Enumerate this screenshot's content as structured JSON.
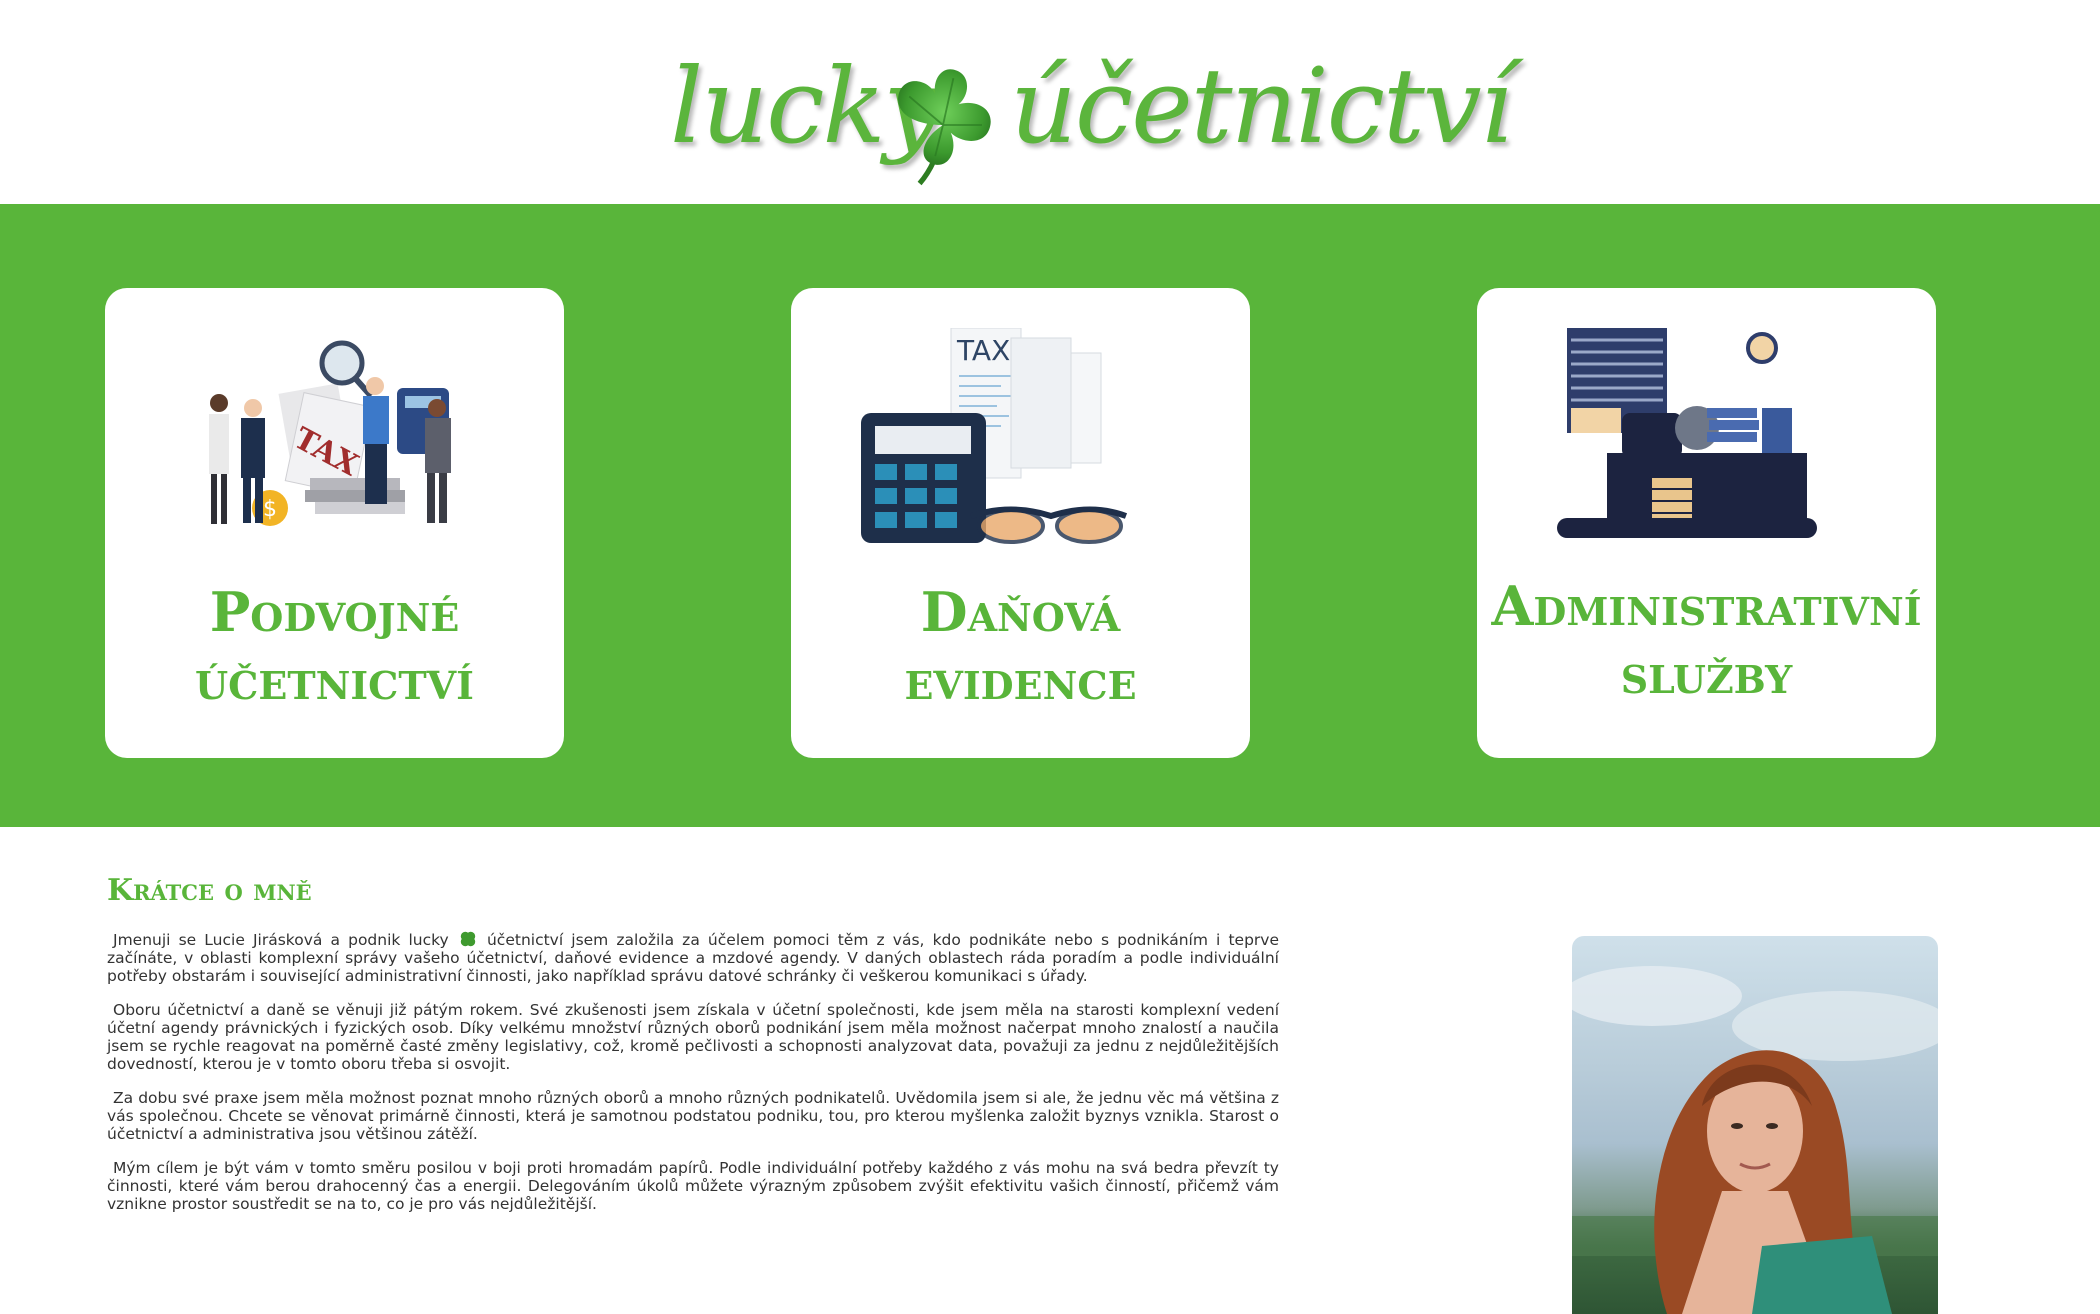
{
  "brand": {
    "logo_left": "lucky",
    "logo_right": "účetnictví",
    "accent_color": "#59b53a"
  },
  "services": [
    {
      "line1": "Podvojné",
      "line2": "účetnictví",
      "icon": "tax-team-illustration"
    },
    {
      "line1": "Daňová",
      "line2": "evidence",
      "icon": "calculator-tax-illustration"
    },
    {
      "line1": "Administrativní",
      "line2": "služby",
      "icon": "office-desk-illustration"
    }
  ],
  "about": {
    "title": "Krátce o mně",
    "p1_before": "Jmenuji se Lucie Jirásková a podnik lucky",
    "p1_after": "účetnictví jsem založila za účelem pomoci těm z vás, kdo podnikáte nebo s podnikáním i teprve začínáte, v oblasti komplexní správy vašeho účetnictví, daňové evidence a mzdové agendy. V daných oblastech ráda poradím a podle individuální potřeby obstarám i související administrativní činnosti, jako například správu datové schránky či veškerou komunikaci s úřady.",
    "p2": "Oboru účetnictví a daně se věnuji již pátým rokem. Své zkušenosti jsem získala v účetní společnosti, kde jsem měla na starosti komplexní vedení účetní agendy právnických i fyzických osob. Díky velkému množství různých oborů podnikání jsem měla možnost načerpat mnoho znalostí a naučila jsem se rychle reagovat na poměrně časté změny legislativy, což, kromě pečlivosti a schopnosti analyzovat data, považuji za jednu z nejdůležitějších dovedností, kterou je v tomto oboru třeba si osvojit.",
    "p3": "Za dobu své praxe jsem měla možnost poznat mnoho různých oborů a mnoho různých podnikatelů. Uvědomila jsem si ale, že jednu věc má většina z vás společnou. Chcete se věnovat primárně činnosti, která je samotnou podstatou podniku, tou, pro kterou myšlenka založit byznys vznikla. Starost o účetnictví a administrativa jsou většinou zátěží.",
    "p4": "Mým cílem je být vám v tomto směru posilou v boji proti hromadám papírů. Podle individuální potřeby každého z vás mohu na svá bedra převzít ty činnosti, které vám berou drahocenný čas a energii. Delegováním úkolů můžete výrazným způsobem zvýšit efektivitu vašich činností, přičemž vám vznikne prostor soustředit se na to, co je pro vás nejdůležitější."
  }
}
